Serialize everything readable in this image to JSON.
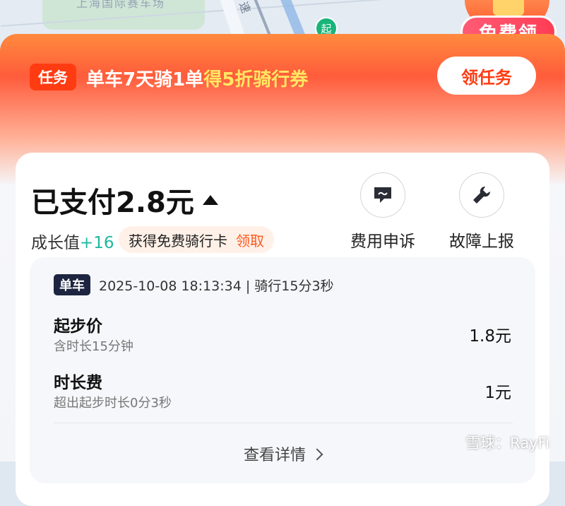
{
  "map": {
    "place_label": "上海国际赛车场",
    "road_label": "速",
    "start_marker": "起"
  },
  "promo": {
    "button": "免费领"
  },
  "task_banner": {
    "tag": "任务",
    "text_main": "单车7天骑1单",
    "text_highlight": "得5折骑行券",
    "button": "领任务"
  },
  "payment": {
    "paid_text": "已支付2.8元",
    "growth_label": "成长值",
    "growth_value": "+16",
    "free_card_text": "获得免费骑行卡",
    "claim_label": "领取"
  },
  "actions": [
    {
      "label": "费用申诉",
      "icon": "chat-complaint-icon"
    },
    {
      "label": "故障上报",
      "icon": "wrench-icon"
    }
  ],
  "trip": {
    "tag": "单车",
    "info": "2025-10-08 18:13:34 | 骑行15分3秒"
  },
  "fees": [
    {
      "name": "起步价",
      "sub": "含时长15分钟",
      "amount": "1.8元"
    },
    {
      "name": "时长费",
      "sub": "超出起步时长0分3秒",
      "amount": "1元"
    }
  ],
  "view_details": "查看详情",
  "watermark": "雪球：RayFi",
  "colors": {
    "accent": "#ff5a1f",
    "growth": "#1fb8a0",
    "task_highlight": "#ffe762"
  }
}
